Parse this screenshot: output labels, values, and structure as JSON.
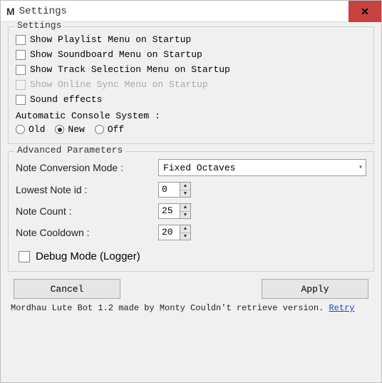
{
  "window": {
    "icon_glyph": "M",
    "title": "Settings",
    "close_glyph": "✕"
  },
  "settings_group": {
    "title": "Settings",
    "chk_playlist": "Show Playlist Menu on Startup",
    "chk_soundboard": "Show Soundboard Menu on Startup",
    "chk_track": "Show Track Selection Menu on Startup",
    "chk_online": "Show Online Sync Menu on Startup",
    "chk_sound": "Sound effects",
    "acs_label": "Automatic Console System :",
    "radio_old": "Old",
    "radio_new": "New",
    "radio_off": "Off",
    "radio_selected": "new"
  },
  "advanced_group": {
    "title": "Advanced Parameters",
    "mode_label": "Note Conversion Mode :",
    "mode_value": "Fixed Octaves",
    "lowest_label": "Lowest Note id :",
    "lowest_value": "0",
    "count_label": "Note Count :",
    "count_value": "25",
    "cooldown_label": "Note Cooldown :",
    "cooldown_value": "20",
    "debug_label": "Debug Mode (Logger)"
  },
  "buttons": {
    "cancel": "Cancel",
    "apply": "Apply"
  },
  "footer": {
    "text": "Mordhau Lute Bot 1.2 made by Monty  Couldn't retrieve version.",
    "retry": "Retry"
  }
}
